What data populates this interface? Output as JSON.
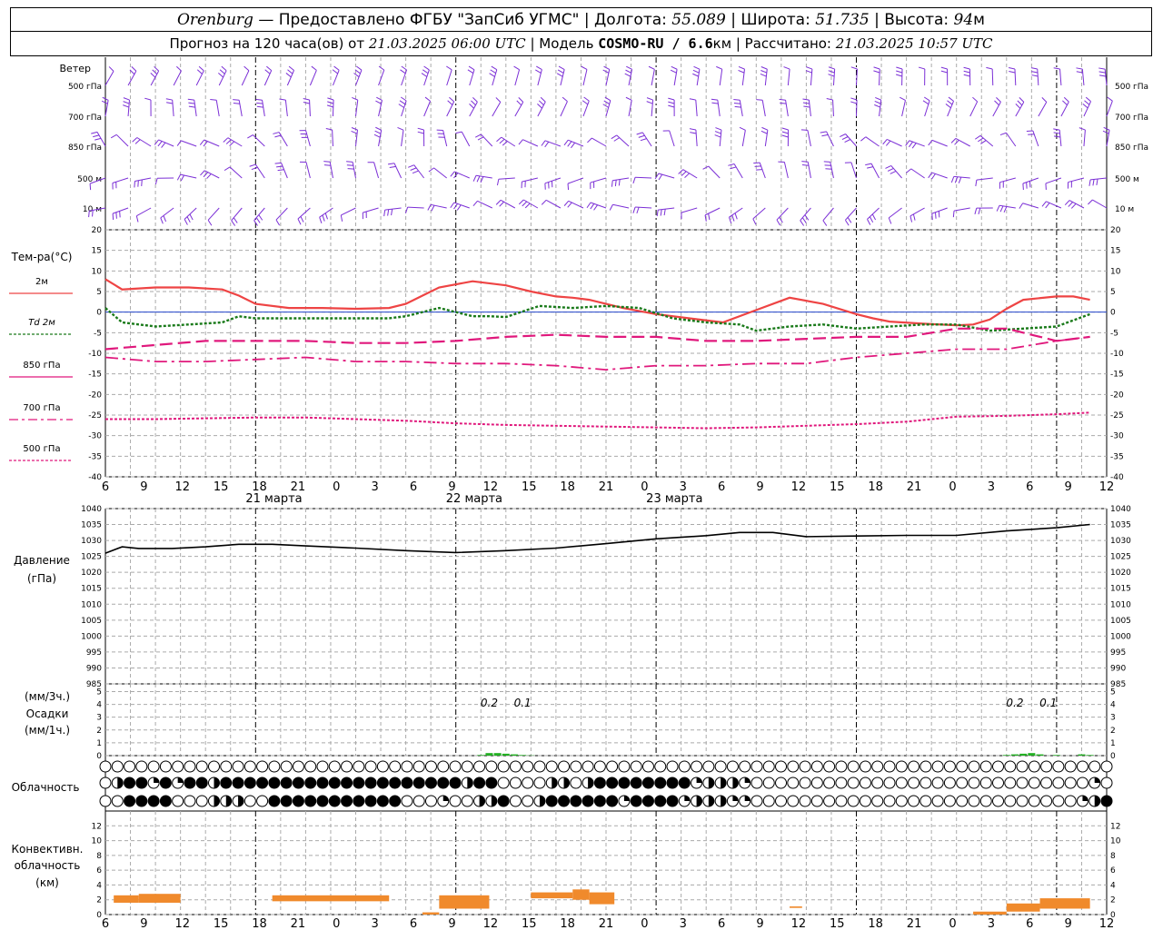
{
  "header": {
    "city": "Orenburg",
    "dash": "—",
    "provider": "Предоставлено ФГБУ \"ЗапСиб УГМС\"",
    "lon_label": "Долгота:",
    "lon_value": "55.089",
    "lat_label": "Широта:",
    "lat_value": "51.735",
    "alt_label": "Высота:",
    "alt_value": "94",
    "alt_unit": "м",
    "forecast_prefix": "Прогноз на 120 часа(ов) от",
    "forecast_time": "21.03.2025 06:00 UTC",
    "model_label": "Модель",
    "model_name": "COSMO-RU / 6.6",
    "model_unit": "км",
    "calc_label": "Рассчитано:",
    "calc_time": "21.03.2025 10:57 UTC",
    "sep": "|"
  },
  "panels": {
    "wind_title": "Ветер",
    "wind_levels": [
      "500 гПа",
      "700 гПа",
      "850 гПа",
      "500 м",
      "10 м"
    ],
    "temp_title": "Тем-ра(°C)",
    "temp_legend": [
      "2м",
      "Td 2м",
      "850 гПа",
      "700 гПа",
      "500 гПа"
    ],
    "pressure_title": "Давление",
    "pressure_unit": "(гПа)",
    "precip_unit_top": "(мм/3ч.)",
    "precip_title": "Осадки",
    "precip_unit_bottom": "(мм/1ч.)",
    "cloud_title": "Облачность",
    "conv_title_1": "Конвективн.",
    "conv_title_2": "облачность",
    "conv_unit": "(км)"
  },
  "time_axis": {
    "tick_labels": [
      "6",
      "9",
      "12",
      "15",
      "18",
      "21",
      "0",
      "3",
      "6",
      "9",
      "12",
      "15",
      "18",
      "21",
      "0",
      "3",
      "6",
      "9",
      "12",
      "15",
      "18",
      "21",
      "0",
      "3",
      "6",
      "9",
      "12"
    ],
    "day_labels": [
      "21 марта",
      "22 марта",
      "23 марта"
    ]
  },
  "colors": {
    "wind": "#7b2fd6",
    "t2m": "#ee4444",
    "td2m": "#1a7a1a",
    "levels": "#e0187c",
    "pressure": "#000000",
    "precip": "#22b022",
    "conv": "#f08a2c",
    "zero_line": "#2244cc"
  },
  "chart_data": [
    {
      "type": "line",
      "title": "Тем-ра(°C)",
      "x_unit": "hours from 21.03 06 UTC",
      "ylim": [
        -40,
        20
      ],
      "yticks": [
        20,
        15,
        10,
        5,
        0,
        -5,
        -10,
        -15,
        -20,
        -25,
        -30,
        -35,
        -40
      ],
      "grid": true,
      "series": [
        {
          "name": "2м",
          "x": [
            0,
            2,
            6,
            10,
            14,
            16,
            18,
            22,
            26,
            30,
            34,
            36,
            38,
            40,
            44,
            48,
            51,
            54,
            56,
            58,
            62,
            66,
            68,
            70,
            74,
            78,
            82,
            86,
            90,
            92,
            94,
            98,
            102,
            104,
            106,
            108,
            110,
            114,
            116,
            118
          ],
          "values": [
            8,
            5.5,
            6,
            6,
            5.5,
            4,
            2,
            1,
            1,
            0.8,
            1,
            2,
            4,
            6,
            7.5,
            6.5,
            5,
            3.8,
            3.5,
            3,
            1,
            -0.5,
            -1,
            -1.5,
            -2.5,
            0.5,
            3.5,
            2,
            -0.5,
            -1.5,
            -2.3,
            -2.8,
            -3.2,
            -3,
            -1.8,
            0.8,
            3,
            3.8,
            3.8,
            3
          ]
        },
        {
          "name": "Td 2м",
          "x": [
            0,
            2,
            6,
            10,
            14,
            16,
            18,
            22,
            26,
            30,
            34,
            36,
            40,
            44,
            46,
            48,
            52,
            56,
            60,
            64,
            68,
            72,
            76,
            78,
            82,
            86,
            90,
            94,
            98,
            102,
            106,
            110,
            114,
            118
          ],
          "values": [
            1,
            -2.5,
            -3.5,
            -3,
            -2.5,
            -1,
            -1.5,
            -1.5,
            -1.5,
            -1.5,
            -1.5,
            -1,
            1,
            -1,
            -1,
            -1.2,
            1.5,
            1,
            1.5,
            1,
            -1.5,
            -2.5,
            -3,
            -4.5,
            -3.5,
            -3,
            -4,
            -3.5,
            -3,
            -3,
            -4.5,
            -4,
            -3.5,
            -0.5
          ]
        },
        {
          "name": "850 гПа",
          "x": [
            0,
            6,
            12,
            18,
            24,
            30,
            36,
            42,
            48,
            54,
            60,
            66,
            72,
            78,
            84,
            90,
            96,
            102,
            108,
            114,
            118
          ],
          "values": [
            -9,
            -8,
            -7,
            -7,
            -7,
            -7.5,
            -7.5,
            -7,
            -6,
            -5.5,
            -6,
            -6,
            -7,
            -7,
            -6.5,
            -6,
            -6,
            -4,
            -4,
            -7,
            -6
          ]
        },
        {
          "name": "700 гПа",
          "x": [
            0,
            6,
            12,
            18,
            24,
            30,
            36,
            42,
            48,
            54,
            60,
            66,
            72,
            78,
            84,
            90,
            96,
            102,
            108,
            114,
            118
          ],
          "values": [
            -11,
            -12,
            -12,
            -11.5,
            -11,
            -12,
            -12,
            -12.5,
            -12.5,
            -13,
            -14,
            -13,
            -13,
            -12.5,
            -12.5,
            -11,
            -10,
            -9,
            -9,
            -7,
            -6
          ]
        },
        {
          "name": "500 гПа",
          "x": [
            0,
            6,
            12,
            18,
            24,
            30,
            36,
            42,
            48,
            54,
            60,
            66,
            72,
            78,
            84,
            90,
            96,
            102,
            108,
            114,
            118
          ],
          "values": [
            -26,
            -26,
            -25.8,
            -25.6,
            -25.6,
            -26,
            -26.4,
            -27,
            -27.4,
            -27.6,
            -27.8,
            -28,
            -28.2,
            -28,
            -27.6,
            -27.2,
            -26.6,
            -25.4,
            -25.2,
            -24.8,
            -24.4
          ]
        }
      ]
    },
    {
      "type": "line",
      "title": "Давление",
      "ylabel": "(гПа)",
      "ylim": [
        985,
        1040
      ],
      "yticks": [
        1040,
        1035,
        1030,
        1025,
        1020,
        1015,
        1010,
        1005,
        1000,
        995,
        990,
        985
      ],
      "series": [
        {
          "x": [
            0,
            2,
            4,
            8,
            12,
            16,
            20,
            24,
            30,
            36,
            42,
            48,
            54,
            60,
            66,
            72,
            76,
            80,
            84,
            90,
            96,
            102,
            108,
            114,
            118
          ],
          "values": [
            1026,
            1028,
            1027.5,
            1027.5,
            1028,
            1028.8,
            1028.8,
            1028.3,
            1027.6,
            1026.8,
            1026.2,
            1026.8,
            1027.6,
            1029,
            1030.5,
            1031.5,
            1032.5,
            1032.5,
            1031.2,
            1031.4,
            1031.6,
            1031.6,
            1033,
            1034,
            1035
          ]
        }
      ]
    },
    {
      "type": "bar",
      "title": "Осадки",
      "ylim": [
        0,
        5
      ],
      "yticks": [
        5,
        4,
        3,
        2,
        1,
        0
      ],
      "annotations": [
        "0.2",
        "0.1",
        "0.2",
        "0.1"
      ],
      "series": [
        {
          "x": [
            45,
            46,
            47,
            48,
            49,
            50,
            51
          ],
          "values": [
            0.05,
            0.2,
            0.2,
            0.15,
            0.1,
            0.05,
            0.02
          ]
        },
        {
          "x": [
            108,
            109,
            110,
            111,
            112,
            114,
            117,
            118
          ],
          "values": [
            0.05,
            0.1,
            0.15,
            0.2,
            0.1,
            0.05,
            0.1,
            0.05
          ]
        }
      ]
    },
    {
      "type": "bar",
      "title": "Конвективн. облачность",
      "ylabel": "(км)",
      "ylim": [
        0,
        13
      ],
      "yticks": [
        12,
        10,
        8,
        6,
        4,
        2,
        0
      ],
      "series": [
        {
          "name": "base-top",
          "segments": [
            {
              "x0": 1,
              "x1": 4,
              "y0": 1.6,
              "y1": 2.6
            },
            {
              "x0": 4,
              "x1": 9,
              "y0": 1.6,
              "y1": 2.8
            },
            {
              "x0": 20,
              "x1": 34,
              "y0": 1.8,
              "y1": 2.6
            },
            {
              "x0": 38,
              "x1": 40,
              "y0": 0,
              "y1": 0.3
            },
            {
              "x0": 40,
              "x1": 46,
              "y0": 0.8,
              "y1": 2.6
            },
            {
              "x0": 51,
              "x1": 56,
              "y0": 2.2,
              "y1": 3.0
            },
            {
              "x0": 56,
              "x1": 58,
              "y0": 2.0,
              "y1": 3.4
            },
            {
              "x0": 58,
              "x1": 61,
              "y0": 1.4,
              "y1": 3.0
            },
            {
              "x0": 82,
              "x1": 83.5,
              "y0": 0.9,
              "y1": 1.1
            },
            {
              "x0": 104,
              "x1": 108,
              "y0": 0,
              "y1": 0.4
            },
            {
              "x0": 108,
              "x1": 112,
              "y0": 0.4,
              "y1": 1.5
            },
            {
              "x0": 112,
              "x1": 118,
              "y0": 0.8,
              "y1": 2.2
            }
          ]
        }
      ]
    }
  ],
  "cloud_rows": [
    "ooooooooooooooooooooooooooooooooooooooooooooooooooooooooooooooooooooooooooooooooooooooooo",
    "oh##q#q##h####################h##oooohhoh########qhhhqooooooooooooooooooooooooooooqoooooooooo",
    "oo####ooohhhoo###########oooqoohh#ooh######q####qhhhqqoooooooooooooooooooooooooooqh######"
  ]
}
